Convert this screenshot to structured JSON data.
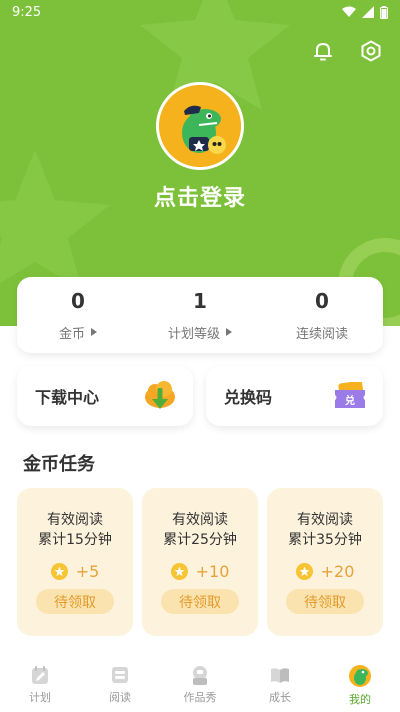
{
  "status_bar": {
    "time": "9:25"
  },
  "header": {
    "login_text": "点击登录"
  },
  "stats": [
    {
      "value": "0",
      "label": "金币"
    },
    {
      "value": "1",
      "label": "计划等级"
    },
    {
      "value": "0",
      "label": "连续阅读"
    }
  ],
  "quick_actions": {
    "download_label": "下载中心",
    "redeem_label": "兑换码"
  },
  "coin_tasks": {
    "title": "金币任务",
    "items": [
      {
        "line1": "有效阅读",
        "line2": "累计15分钟",
        "reward": "+5",
        "button": "待领取"
      },
      {
        "line1": "有效阅读",
        "line2": "累计25分钟",
        "reward": "+10",
        "button": "待领取"
      },
      {
        "line1": "有效阅读",
        "line2": "累计35分钟",
        "reward": "+20",
        "button": "待领取"
      }
    ]
  },
  "nav": {
    "items": [
      {
        "label": "计划",
        "icon": "plan-icon"
      },
      {
        "label": "阅读",
        "icon": "read-icon"
      },
      {
        "label": "作品秀",
        "icon": "showcase-icon"
      },
      {
        "label": "成长",
        "icon": "growth-icon"
      },
      {
        "label": "我的",
        "icon": "profile-icon"
      }
    ],
    "active_index": 4
  },
  "colors": {
    "header_green": "#7dc13a",
    "task_card_bg": "#fdf3dd",
    "coin_orange": "#e7a23a",
    "active_nav": "#5aa62c"
  }
}
